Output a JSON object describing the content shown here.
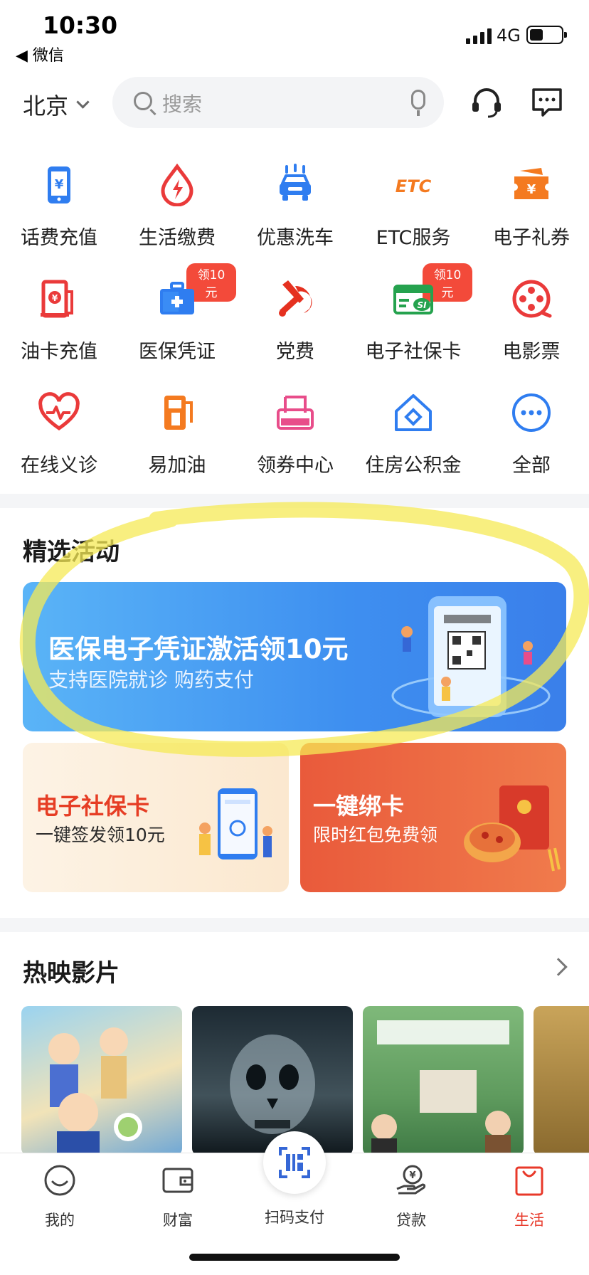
{
  "status_bar": {
    "time": "10:30",
    "back_app": "◀ 微信",
    "network": "4G"
  },
  "header": {
    "city": "北京",
    "search_placeholder": "搜索"
  },
  "services": [
    {
      "label": "话费充值",
      "icon": "phone-recharge-icon"
    },
    {
      "label": "生活缴费",
      "icon": "utility-drop-icon"
    },
    {
      "label": "优惠洗车",
      "icon": "car-wash-icon"
    },
    {
      "label": "ETC服务",
      "icon": "etc-icon",
      "icon_text": "ETC"
    },
    {
      "label": "电子礼券",
      "icon": "gift-coupon-icon"
    },
    {
      "label": "油卡充值",
      "icon": "fuel-card-icon"
    },
    {
      "label": "医保凭证",
      "icon": "medical-kit-icon",
      "badge": "领10元"
    },
    {
      "label": "党费",
      "icon": "party-emblem-icon"
    },
    {
      "label": "电子社保卡",
      "icon": "social-security-card-icon",
      "badge": "领10元"
    },
    {
      "label": "电影票",
      "icon": "film-reel-icon"
    },
    {
      "label": "在线义诊",
      "icon": "heart-pulse-icon"
    },
    {
      "label": "易加油",
      "icon": "gas-pump-icon"
    },
    {
      "label": "领券中心",
      "icon": "coupon-center-icon"
    },
    {
      "label": "住房公积金",
      "icon": "housing-fund-icon"
    },
    {
      "label": "全部",
      "icon": "more-dots-icon"
    }
  ],
  "activities": {
    "title": "精选活动",
    "banner": {
      "title": "医保电子凭证激活领10元",
      "subtitle": "支持医院就诊  购药支付"
    },
    "cards": [
      {
        "title": "电子社保卡",
        "subtitle": "一键签发领10元"
      },
      {
        "title": "一键绑卡",
        "subtitle": "限时红包免费领"
      }
    ]
  },
  "movies": {
    "title": "热映影片",
    "posters": [
      "poster-1",
      "poster-2",
      "poster-3",
      "poster-4"
    ]
  },
  "tabbar": [
    {
      "label": "我的",
      "icon": "profile-face-icon"
    },
    {
      "label": "财富",
      "icon": "wallet-icon"
    },
    {
      "label": "扫码支付",
      "icon": "scan-pay-icon"
    },
    {
      "label": "贷款",
      "icon": "loan-hand-icon"
    },
    {
      "label": "生活",
      "icon": "shopping-bag-icon",
      "active": true
    }
  ],
  "colors": {
    "accent_red": "#e8392a",
    "accent_blue": "#2f7df0",
    "badge_red": "#f34a3a"
  }
}
